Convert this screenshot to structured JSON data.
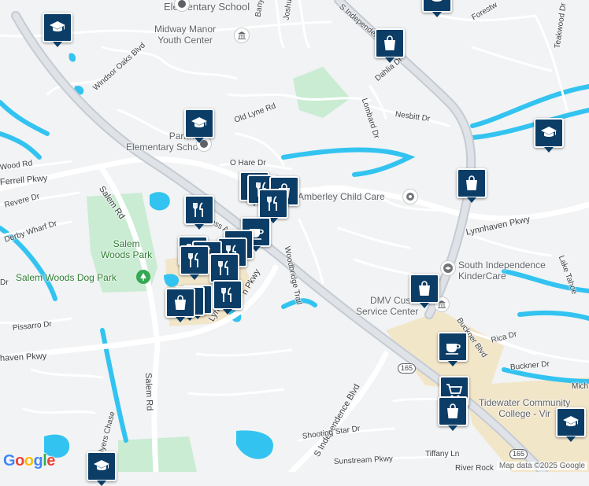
{
  "map": {
    "attribution": "Map data ©2025 Google",
    "logo": {
      "letters": [
        {
          "ch": "G",
          "color": "#4285f4"
        },
        {
          "ch": "o",
          "color": "#ea4335"
        },
        {
          "ch": "o",
          "color": "#fbbc05"
        },
        {
          "ch": "g",
          "color": "#4285f4"
        },
        {
          "ch": "l",
          "color": "#34a853"
        },
        {
          "ch": "e",
          "color": "#ea4335"
        }
      ]
    },
    "colors": {
      "background": "#f1f3f4",
      "water": "#33c3f0",
      "park": "#c9ecd2",
      "commercial": "#f2e6c9",
      "road": "#ffffff",
      "highway": "#d7dce2",
      "marker": "#0b3d66"
    },
    "streets": {
      "elementary_school_top": "Elementary School",
      "banyan": "Banyan",
      "joshua": "Joshua",
      "s_independence_top": "S Independence",
      "forestwood": "Forestw",
      "teakwood": "Teakwood Dr",
      "windsor_oaks": "Windsor Oaks Blvd",
      "old_lyne": "Old Lyne Rd",
      "dahlia": "Dahlia Dr",
      "lombard": "Lombard Dr",
      "nesbitt": "Nesbitt Dr",
      "o_hare": "O Hare Dr",
      "woodrd": "Wood Rd",
      "ferrell": "Ferrell Pkwy",
      "salem_rd_upper": "Salem Rd",
      "revere": "Revere Dr",
      "derby_wharf": "Derby Wharf Dr",
      "dr_left": "Dr",
      "lynnhaven_right": "Lynnhaven Pkwy",
      "woodbridge": "Woodbridge Trail",
      "lake_tahoe": "Lake Tahoe",
      "lynn_pkwy_frag": "Lyn",
      "lynn_pkwy_frag2": "n Pkwy",
      "ess_frag": "ess A",
      "pissarro": "Pissarro Dr",
      "buckner_blvd": "Buckner Blvd",
      "rica": "Rica Dr",
      "buckner_dr": "Buckner Dr",
      "lynnhaven_left": "haven Pkwy",
      "salem_rd_lower": "Salem Rd",
      "s_independence_lower": "S Independence Blvd",
      "greylyers": "Greylyers Chase",
      "shooting_star": "Shooting Star Dr",
      "sunstream": "Sunstream Pkwy",
      "tiffany": "Tiffany Ln",
      "river_rock": "River Rock",
      "mich": "Mich",
      "route_165": "165"
    },
    "places": {
      "midway": "Midway Manor\nYouth Center",
      "parkway": "Parkway\nElementary School",
      "amberley": "Amberley Child Care",
      "south_indep": "South Independence\nKinderCare",
      "dmv": "DMV Custo\nService Center",
      "tidewater": "Tidewater Community\nCollege - Vir",
      "salem_woods_park": "Salem\nWoods Park",
      "dog_park": "Salem Woods Dog Park"
    },
    "markers": [
      {
        "id": "school-top-left",
        "icon": "school"
      },
      {
        "id": "shop-dahlia",
        "icon": "shop"
      },
      {
        "id": "school-top-right",
        "icon": "school"
      },
      {
        "id": "school-parkway",
        "icon": "school"
      },
      {
        "id": "school-right",
        "icon": "school"
      },
      {
        "id": "shop-east",
        "icon": "shop"
      },
      {
        "id": "food-1",
        "icon": "food"
      },
      {
        "id": "food-2",
        "icon": "food"
      },
      {
        "id": "food-3",
        "icon": "food"
      },
      {
        "id": "shop-cluster-1",
        "icon": "shop"
      },
      {
        "id": "food-4",
        "icon": "food"
      },
      {
        "id": "cafe-1",
        "icon": "cafe"
      },
      {
        "id": "food-5",
        "icon": "food"
      },
      {
        "id": "food-6",
        "icon": "food"
      },
      {
        "id": "food-7",
        "icon": "food"
      },
      {
        "id": "food-8",
        "icon": "food"
      },
      {
        "id": "food-9",
        "icon": "food"
      },
      {
        "id": "food-10",
        "icon": "food"
      },
      {
        "id": "shop-cluster-2",
        "icon": "shop"
      },
      {
        "id": "shop-cluster-3",
        "icon": "shop"
      },
      {
        "id": "food-11",
        "icon": "food"
      },
      {
        "id": "shop-dmv",
        "icon": "shop"
      },
      {
        "id": "cafe-2",
        "icon": "cafe"
      },
      {
        "id": "cart-1",
        "icon": "cart"
      },
      {
        "id": "shop-south",
        "icon": "shop"
      },
      {
        "id": "school-tidewater",
        "icon": "school"
      },
      {
        "id": "school-bottom",
        "icon": "school"
      }
    ]
  }
}
